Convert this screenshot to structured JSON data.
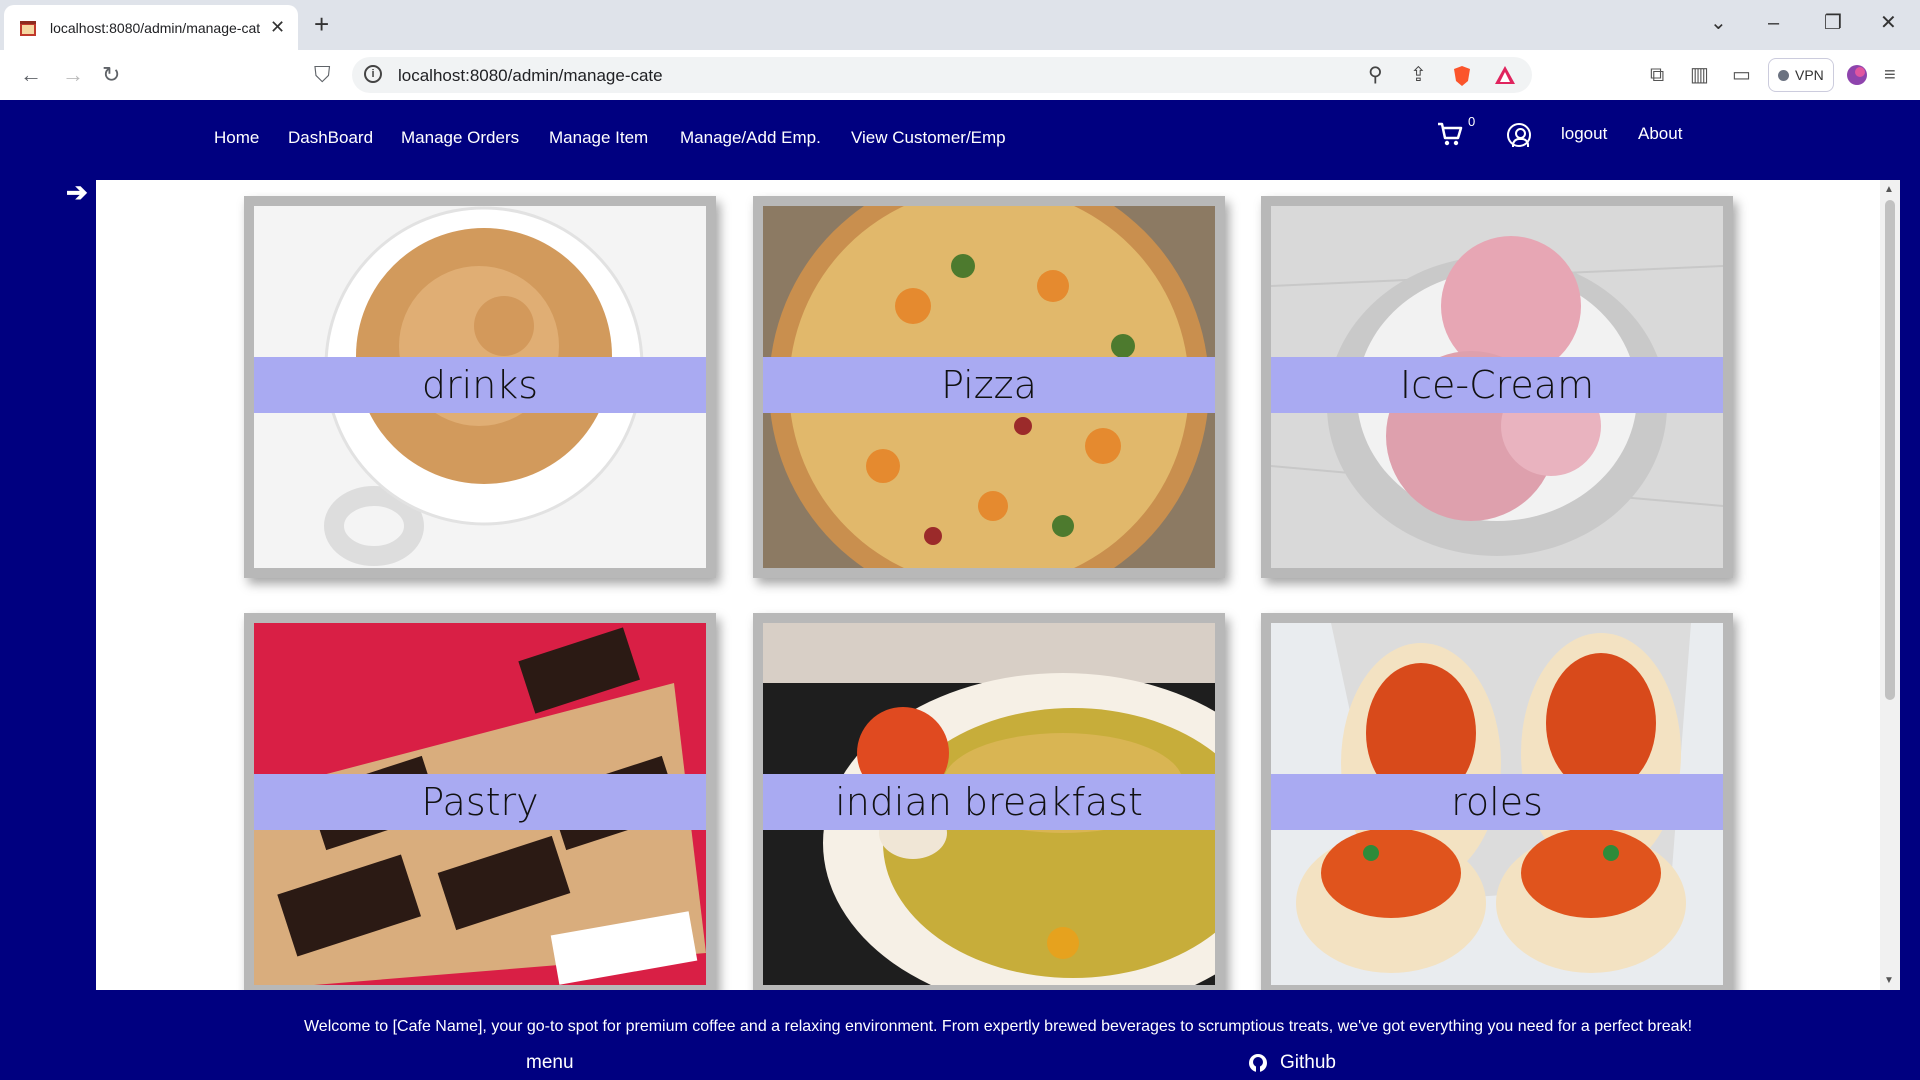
{
  "browser": {
    "tab_title": "localhost:8080/admin/manage-cate",
    "url": "localhost:8080/admin/manage-cate",
    "vpn_label": "VPN"
  },
  "nav": {
    "links": [
      "Home",
      "DashBoard",
      "Manage Orders",
      "Manage Item",
      "Manage/Add Emp.",
      "View Customer/Emp"
    ],
    "cart_count": "0",
    "logout": "logout",
    "about": "About"
  },
  "categories": [
    {
      "label": "drinks",
      "image": "coffee-cup"
    },
    {
      "label": "Pizza",
      "image": "pizza"
    },
    {
      "label": "Ice-Cream",
      "image": "ice-cream-bowl"
    },
    {
      "label": "Pastry",
      "image": "chocolate-pastries"
    },
    {
      "label": "indian breakfast",
      "image": "poha-plate"
    },
    {
      "label": "roles",
      "image": "wrap-rolls"
    }
  ],
  "footer": {
    "text": "Welcome to [Cafe Name], your go-to spot for premium coffee and a relaxing environment. From expertly brewed beverages to scrumptious treats, we've got everything you need for a perfect break!",
    "menu": "menu",
    "github": "Github"
  },
  "colors": {
    "navbar": "#000080",
    "label_band": "#a9aaf2",
    "card_frame": "#b8b8b8"
  }
}
